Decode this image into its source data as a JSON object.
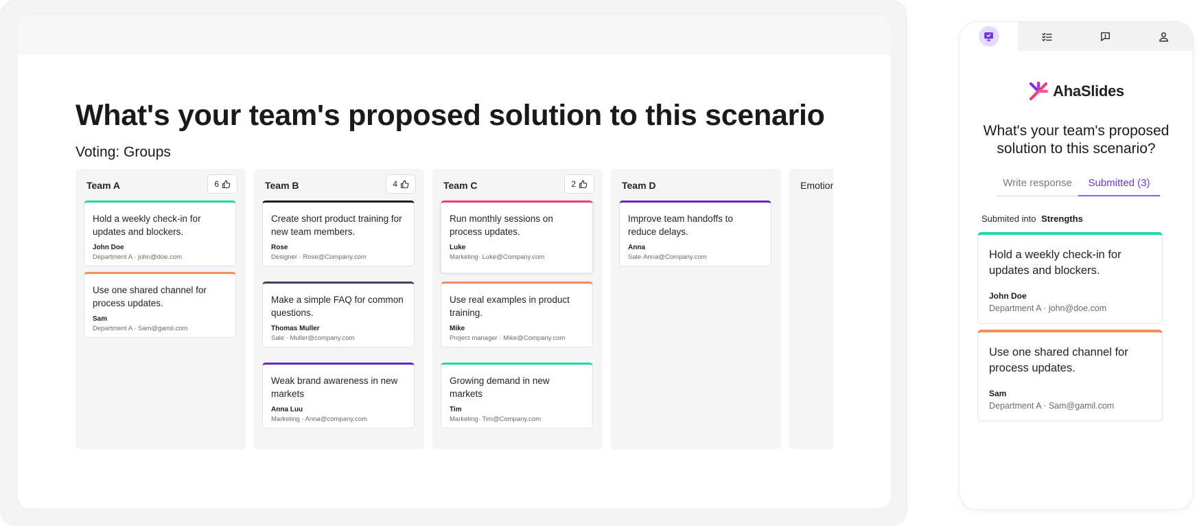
{
  "presenter": {
    "title": "What's your team's proposed solution to this scenario",
    "subtitle": "Voting: Groups",
    "columns": [
      {
        "name": "Team A",
        "votes": "6",
        "cards": [
          {
            "text": "Hold a weekly check-in for updates and blockers.",
            "author": "John Doe",
            "meta": "Department A · john@doe.com",
            "color": "#25d5a8"
          },
          {
            "text": "Use one shared channel for process updates.",
            "author": "Sam",
            "meta": "Department A · Sam@gamil.com",
            "color": "#f58d5c"
          }
        ]
      },
      {
        "name": "Team B",
        "votes": "4",
        "cards": [
          {
            "text": "Create short product training for new team members.",
            "author": "Rose",
            "meta": "Designer · Rose@Company.com",
            "color": "#1c1c24"
          },
          {
            "text": "Make a simple FAQ for common questions.",
            "author": "Thomas Muller",
            "meta": "Sale · Muller@company.com",
            "color": "#414361"
          },
          {
            "text": "Weak brand awareness in new markets",
            "author": "Anna Luu",
            "meta": "Marketing · Anna@company.com",
            "color": "#6a22c4"
          }
        ]
      },
      {
        "name": "Team C",
        "votes": "2",
        "cards": [
          {
            "text": "Run monthly sessions on process updates.",
            "author": "Luke",
            "meta": "Marketing· Luke@Company.com",
            "color": "#ef3f72"
          },
          {
            "text": " Use real examples in product training.",
            "author": "Mike",
            "meta": "Project manager · Mike@Company.com",
            "color": "#f58d5c"
          },
          {
            "text": "Growing demand in new markets",
            "author": "Tim",
            "meta": "Marketing· Tim@Company.com",
            "color": "#25d5a8"
          }
        ]
      },
      {
        "name": "Team D",
        "votes": "",
        "cards": [
          {
            "text": "Improve team handoffs to reduce delays.",
            "author": "Anna",
            "meta": "Sale·Anna@Company.com",
            "color": "#6a22c4"
          }
        ]
      },
      {
        "name": "Emotion",
        "votes": "",
        "cards": []
      }
    ]
  },
  "phone": {
    "nav": {
      "items": [
        {
          "icon": "presentation-icon",
          "active": true
        },
        {
          "icon": "checklist-icon",
          "active": false
        },
        {
          "icon": "chat-icon",
          "active": false
        },
        {
          "icon": "user-icon",
          "active": false
        }
      ]
    },
    "brand": "AhaSlides",
    "question": "What's your team's proposed solution to this scenario?",
    "tabs": {
      "write": "Write response",
      "submitted": "Submitted (3)"
    },
    "submitted_into_label": "Submited into",
    "submitted_into_value": "Strengths",
    "cards": [
      {
        "text": "Hold a weekly check-in for updates and blockers.",
        "author": "John Doe",
        "meta": "Department A · john@doe.com",
        "color": "#25d5a8"
      },
      {
        "text": "Use one shared channel for process updates.",
        "author": "Sam",
        "meta": "Department A · Sam@gamil.com",
        "color": "#f58d5c"
      }
    ]
  },
  "colors": {
    "accent": "#6d36e2",
    "accent_light": "#e7dbfa",
    "brand_gradient_a": "#ef3f72",
    "brand_gradient_b": "#7b2ff2"
  }
}
